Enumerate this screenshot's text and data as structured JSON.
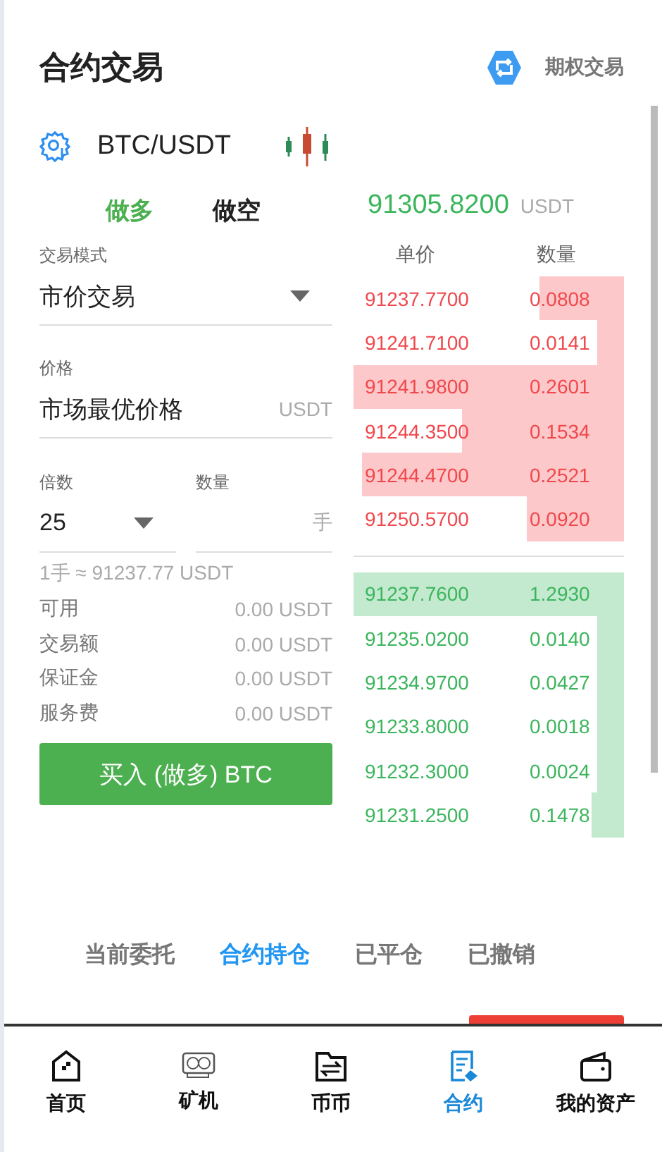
{
  "header": {
    "title": "合约交易",
    "link": "期权交易"
  },
  "pair": {
    "symbol": "BTC/USDT"
  },
  "sides": [
    {
      "label": "做多",
      "selected": true
    },
    {
      "label": "做空",
      "selected": false
    }
  ],
  "last_price": {
    "value": "91305.8200",
    "unit": "USDT"
  },
  "form": {
    "mode_label": "交易模式",
    "mode_value": "市价交易",
    "price_label": "价格",
    "price_value": "市场最优价格",
    "price_unit": "USDT",
    "leverage_label": "倍数",
    "leverage_value": "25",
    "quantity_label": "数量",
    "quantity_unit": "手",
    "lot_note": "1手 ≈ 91237.77 USDT"
  },
  "summary": [
    {
      "label": "可用",
      "value": "0.00 USDT"
    },
    {
      "label": "交易额",
      "value": "0.00 USDT"
    },
    {
      "label": "保证金",
      "value": "0.00 USDT"
    },
    {
      "label": "服务费",
      "value": "0.00 USDT"
    }
  ],
  "buy_button": "买入 (做多) BTC",
  "order_book": {
    "columns": [
      "单价",
      "数量"
    ],
    "asks": [
      {
        "price": "91237.7700",
        "amount": "0.0808"
      },
      {
        "price": "91241.7100",
        "amount": "0.0141"
      },
      {
        "price": "91241.9800",
        "amount": "0.2601"
      },
      {
        "price": "91244.3500",
        "amount": "0.1534"
      },
      {
        "price": "91244.4700",
        "amount": "0.2521"
      },
      {
        "price": "91250.5700",
        "amount": "0.0920"
      }
    ],
    "bids": [
      {
        "price": "91237.7600",
        "amount": "1.2930"
      },
      {
        "price": "91235.0200",
        "amount": "0.0140"
      },
      {
        "price": "91234.9700",
        "amount": "0.0427"
      },
      {
        "price": "91233.8000",
        "amount": "0.0018"
      },
      {
        "price": "91232.3000",
        "amount": "0.0024"
      },
      {
        "price": "91231.2500",
        "amount": "0.1478"
      }
    ]
  },
  "order_tabs": [
    {
      "label": "当前委托",
      "selected": false
    },
    {
      "label": "合约持仓",
      "selected": true
    },
    {
      "label": "已平仓",
      "selected": false
    },
    {
      "label": "已撤销",
      "selected": false
    }
  ],
  "bottom_nav": [
    {
      "label": "首页",
      "selected": false
    },
    {
      "label": "矿机",
      "selected": false
    },
    {
      "label": "币币",
      "selected": false
    },
    {
      "label": "合约",
      "selected": true
    },
    {
      "label": "我的资产",
      "selected": false
    }
  ]
}
